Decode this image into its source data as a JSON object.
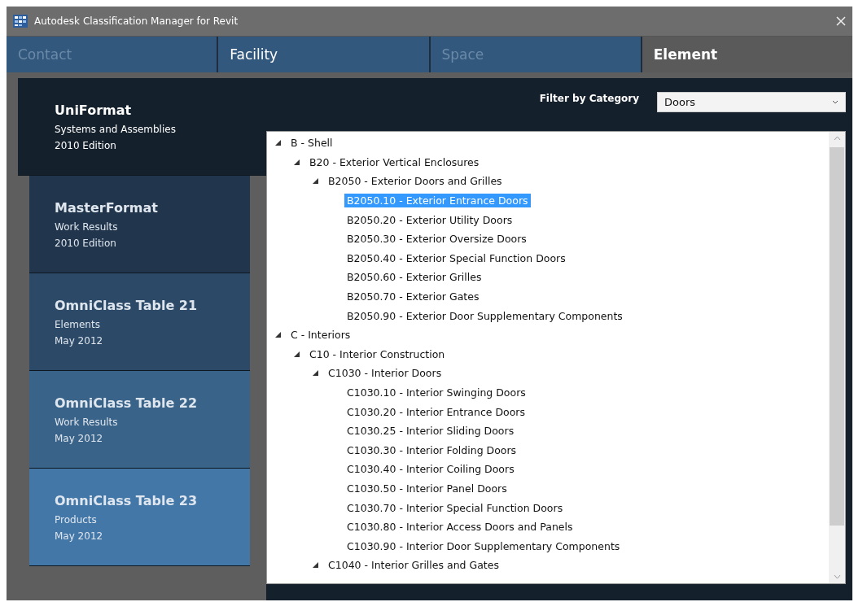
{
  "window": {
    "title": "Autodesk Classification Manager for Revit"
  },
  "tabs": [
    {
      "label": "Contact",
      "selected": false,
      "disabled": true
    },
    {
      "label": "Facility",
      "selected": false,
      "disabled": false
    },
    {
      "label": "Space",
      "selected": false,
      "disabled": true
    },
    {
      "label": "Element",
      "selected": true,
      "disabled": false
    }
  ],
  "sidebar": {
    "items": [
      {
        "title": "UniFormat",
        "subtitle": "Systems and Assemblies",
        "edition": "2010 Edition",
        "selected": true,
        "color": "#15202d"
      },
      {
        "title": "MasterFormat",
        "subtitle": "Work Results",
        "edition": "2010 Edition",
        "selected": false,
        "color": "#21354d"
      },
      {
        "title": "OmniClass Table 21",
        "subtitle": "Elements",
        "edition": "May 2012",
        "selected": false,
        "color": "#2c4a68"
      },
      {
        "title": "OmniClass Table 22",
        "subtitle": "Work Results",
        "edition": "May 2012",
        "selected": false,
        "color": "#396388"
      },
      {
        "title": "OmniClass Table 23",
        "subtitle": "Products",
        "edition": "May 2012",
        "selected": false,
        "color": "#4377a8"
      }
    ]
  },
  "filter": {
    "label": "Filter by Category",
    "value": "Doors"
  },
  "tree": [
    {
      "label": "B - Shell",
      "expanded": true,
      "children": [
        {
          "label": "B20 - Exterior Vertical Enclosures",
          "expanded": true,
          "children": [
            {
              "label": "B2050 - Exterior Doors and Grilles",
              "expanded": true,
              "children": [
                {
                  "label": "B2050.10 - Exterior Entrance Doors",
                  "selected": true
                },
                {
                  "label": "B2050.20 - Exterior Utility Doors",
                  "selected": false
                },
                {
                  "label": "B2050.30 - Exterior Oversize Doors",
                  "selected": false
                },
                {
                  "label": "B2050.40 - Exterior Special Function Doors",
                  "selected": false
                },
                {
                  "label": "B2050.60 - Exterior Grilles",
                  "selected": false
                },
                {
                  "label": "B2050.70 - Exterior Gates",
                  "selected": false
                },
                {
                  "label": "B2050.90 - Exterior Door Supplementary Components",
                  "selected": false
                }
              ]
            }
          ]
        }
      ]
    },
    {
      "label": "C - Interiors",
      "expanded": true,
      "children": [
        {
          "label": "C10 - Interior Construction",
          "expanded": true,
          "children": [
            {
              "label": "C1030 - Interior Doors",
              "expanded": true,
              "children": [
                {
                  "label": "C1030.10 - Interior Swinging Doors",
                  "selected": false
                },
                {
                  "label": "C1030.20 - Interior Entrance Doors",
                  "selected": false
                },
                {
                  "label": "C1030.25 - Interior Sliding Doors",
                  "selected": false
                },
                {
                  "label": "C1030.30 - Interior Folding Doors",
                  "selected": false
                },
                {
                  "label": "C1030.40 - Interior Coiling Doors",
                  "selected": false
                },
                {
                  "label": "C1030.50 - Interior Panel Doors",
                  "selected": false
                },
                {
                  "label": "C1030.70 - Interior Special Function Doors",
                  "selected": false
                },
                {
                  "label": "C1030.80 - Interior Access Doors and Panels",
                  "selected": false
                },
                {
                  "label": "C1030.90 - Interior Door Supplementary Components",
                  "selected": false
                }
              ]
            },
            {
              "label": "C1040 - Interior Grilles and Gates",
              "expanded": true
            }
          ]
        }
      ]
    }
  ]
}
